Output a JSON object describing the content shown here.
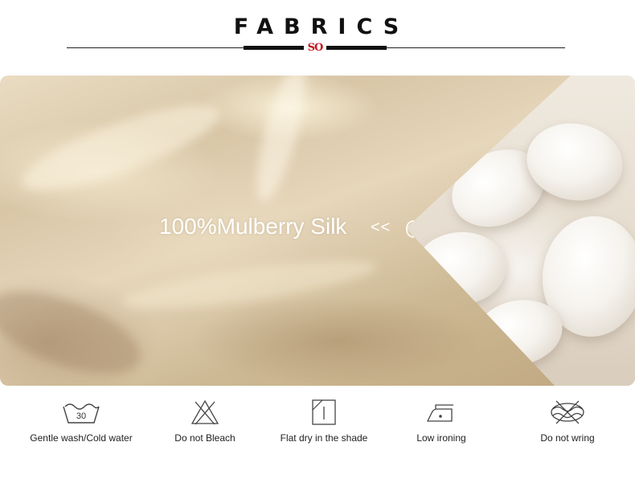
{
  "header": {
    "title": "FABRICS",
    "logo_text": "SO"
  },
  "hero": {
    "headline": "100%Mulberry Silk",
    "arrows": "<<"
  },
  "care": {
    "items": [
      {
        "icon": "wash-tub-30-icon",
        "label": "Gentle wash/Cold water",
        "badge": "30"
      },
      {
        "icon": "no-bleach-icon",
        "label": "Do not Bleach"
      },
      {
        "icon": "flat-dry-shade-icon",
        "label": "Flat dry in the shade"
      },
      {
        "icon": "low-iron-icon",
        "label": "Low ironing"
      },
      {
        "icon": "no-wring-icon",
        "label": "Do not wring"
      }
    ]
  },
  "colors": {
    "logo_red": "#c4161c",
    "text_dark": "#222222",
    "silk_base": "#d8c6a6"
  }
}
